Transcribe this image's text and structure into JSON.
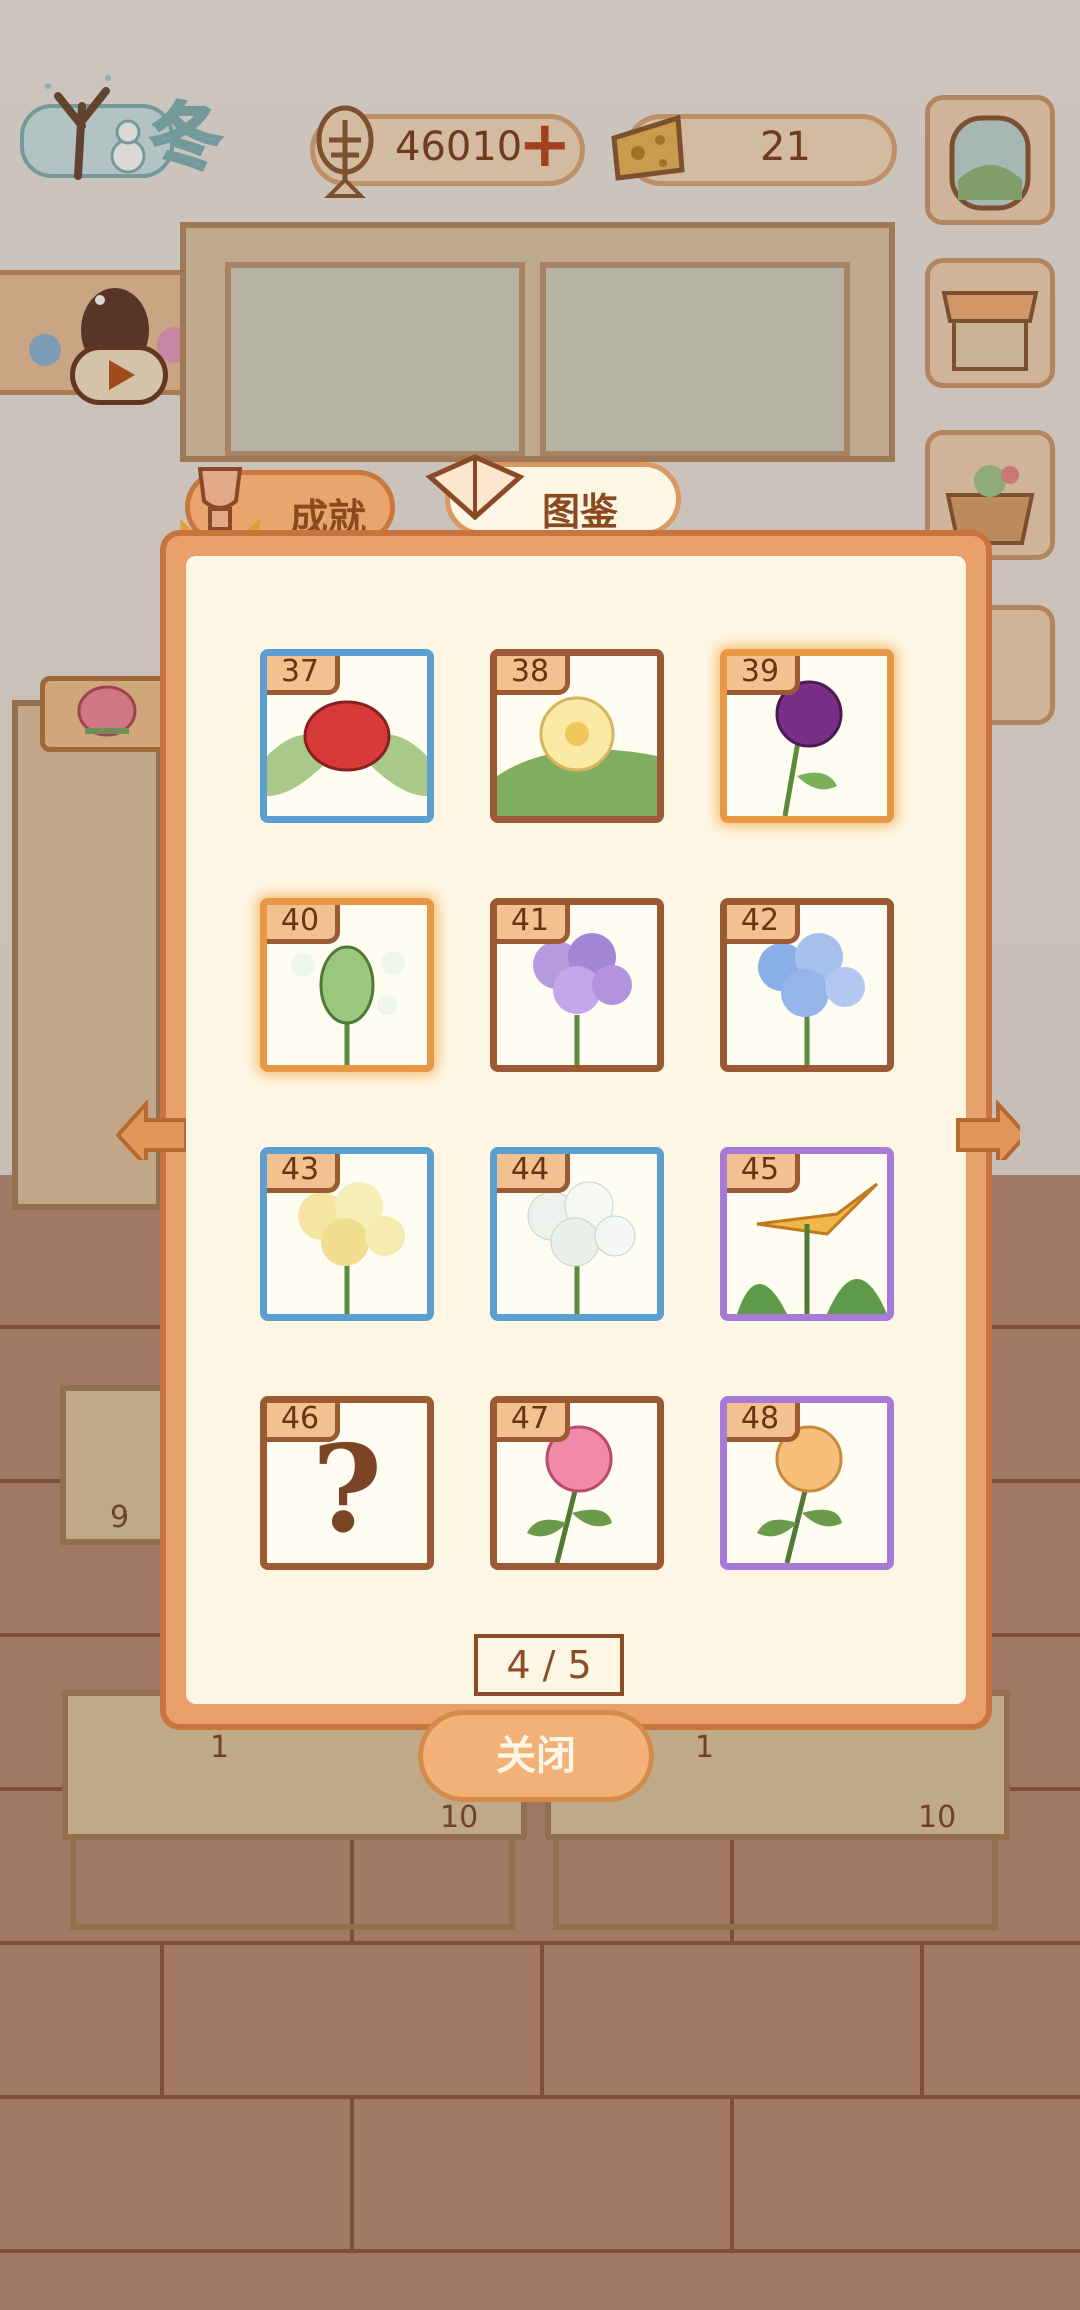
{
  "season": {
    "label": "冬"
  },
  "currency": {
    "fish_bones": "46010",
    "cheese": "21"
  },
  "tabs": [
    {
      "label": "成就",
      "icon": "trophy-icon",
      "active": false
    },
    {
      "label": "图鉴",
      "icon": "book-icon",
      "active": true
    }
  ],
  "collection": {
    "cards": [
      {
        "number": "37",
        "flower": "red-flower",
        "frame": "blue",
        "unlocked": true
      },
      {
        "number": "38",
        "flower": "plumeria",
        "frame": "brown",
        "unlocked": true
      },
      {
        "number": "39",
        "flower": "purple-rose",
        "frame": "glow",
        "unlocked": true
      },
      {
        "number": "40",
        "flower": "white-bud",
        "frame": "glow",
        "unlocked": true
      },
      {
        "number": "41",
        "flower": "purple-hydrangea",
        "frame": "brown",
        "unlocked": true
      },
      {
        "number": "42",
        "flower": "blue-hydrangea",
        "frame": "brown",
        "unlocked": true
      },
      {
        "number": "43",
        "flower": "yellow-hydrangea",
        "frame": "blue",
        "unlocked": true
      },
      {
        "number": "44",
        "flower": "white-hydrangea",
        "frame": "blue",
        "unlocked": true
      },
      {
        "number": "45",
        "flower": "bird-of-paradise",
        "frame": "purple",
        "unlocked": true
      },
      {
        "number": "46",
        "flower": "unknown",
        "frame": "brown",
        "unlocked": false,
        "placeholder": "?"
      },
      {
        "number": "47",
        "flower": "pink-rose",
        "frame": "brown",
        "unlocked": true
      },
      {
        "number": "48",
        "flower": "peach-rose",
        "frame": "purple",
        "unlocked": true
      }
    ],
    "page_indicator": "4 / 5"
  },
  "buttons": {
    "close": "关闭"
  },
  "background": {
    "table_numbers": [
      "9",
      "1",
      "10",
      "1",
      "10"
    ]
  },
  "colors": {
    "dialog_frame": "#eaa06a",
    "dialog_bg": "#fdf6e4",
    "frame_blue": "#5a9fcf",
    "frame_brown": "#9b5a33",
    "frame_purple": "#a77ad8",
    "frame_glow": "#e79745"
  }
}
